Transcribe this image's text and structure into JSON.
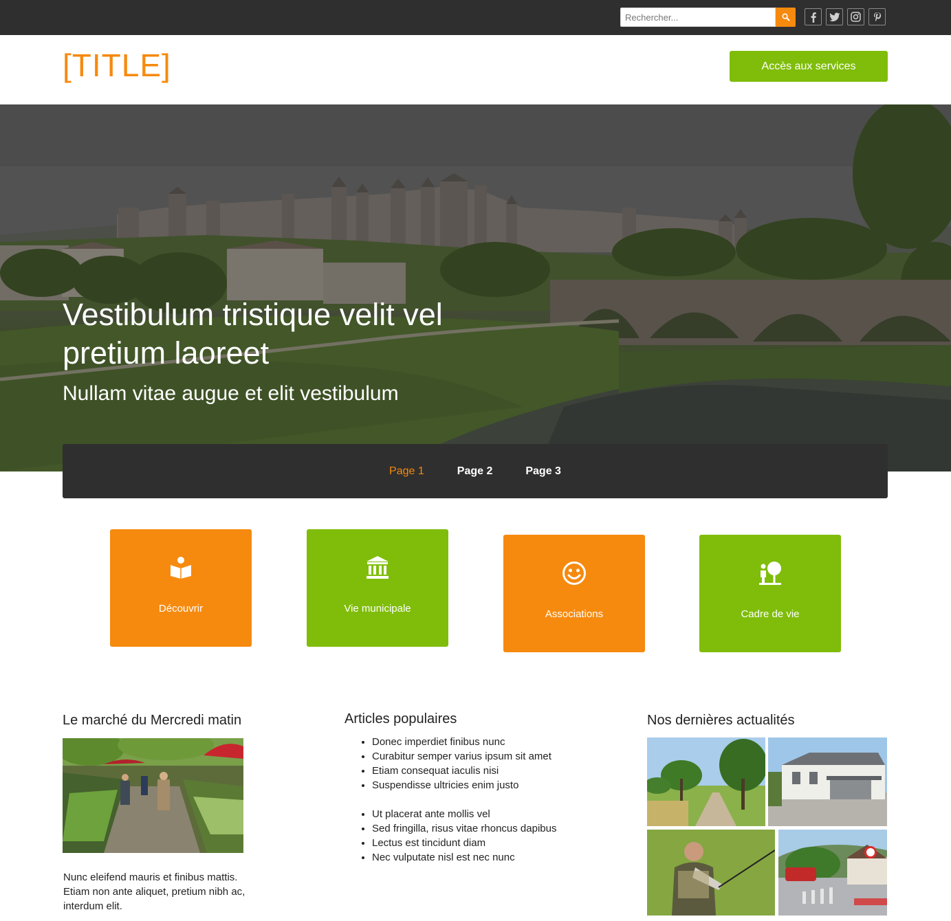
{
  "search": {
    "placeholder": "Rechercher..."
  },
  "socials": [
    {
      "icon": "facebook-icon",
      "glyph": "f"
    },
    {
      "icon": "twitter-icon",
      "glyph": "t"
    },
    {
      "icon": "instagram-icon",
      "glyph": "ig"
    },
    {
      "icon": "pinterest-icon",
      "glyph": "p"
    }
  ],
  "header": {
    "title": "[TITLE]",
    "services_label": "Accès aux services"
  },
  "hero": {
    "title": "Vestibulum tristique velit vel pretium laoreet",
    "subtitle": "Nullam vitae augue et elit vestibulum"
  },
  "nav": {
    "items": [
      "Page 1",
      "Page 2",
      "Page 3"
    ],
    "active": "Page 1"
  },
  "tiles": [
    {
      "label": "Découvrir",
      "icon": "book-reader-icon",
      "color": "#f68a0f"
    },
    {
      "label": "Vie municipale",
      "icon": "town-hall-icon",
      "color": "#7fbd0a"
    },
    {
      "label": "Associations",
      "icon": "smiley-icon",
      "color": "#f68a0f"
    },
    {
      "label": "Cadre de vie",
      "icon": "person-tree-icon",
      "color": "#7fbd0a"
    }
  ],
  "market": {
    "title": "Le marché du Mercredi matin",
    "text": "Nunc eleifend mauris et finibus mattis. Etiam non ante aliquet, pretium nibh ac, interdum elit."
  },
  "popular": {
    "title": "Articles populaires",
    "group1": [
      "Donec imperdiet finibus nunc",
      "Curabitur semper varius ipsum sit amet",
      "Etiam consequat iaculis nisi",
      "Suspendisse ultricies enim justo"
    ],
    "group2": [
      "Ut placerat ante mollis vel",
      "Sed fringilla, risus vitae rhoncus dapibus",
      "Lectus est tincidunt diam",
      "Nec vulputate nisl est nec nunc"
    ]
  },
  "news": {
    "title": "Nos dernières actualités"
  },
  "colors": {
    "accent": "#f68a0f",
    "green": "#7fbd0a",
    "dark": "#2f2f2f"
  }
}
